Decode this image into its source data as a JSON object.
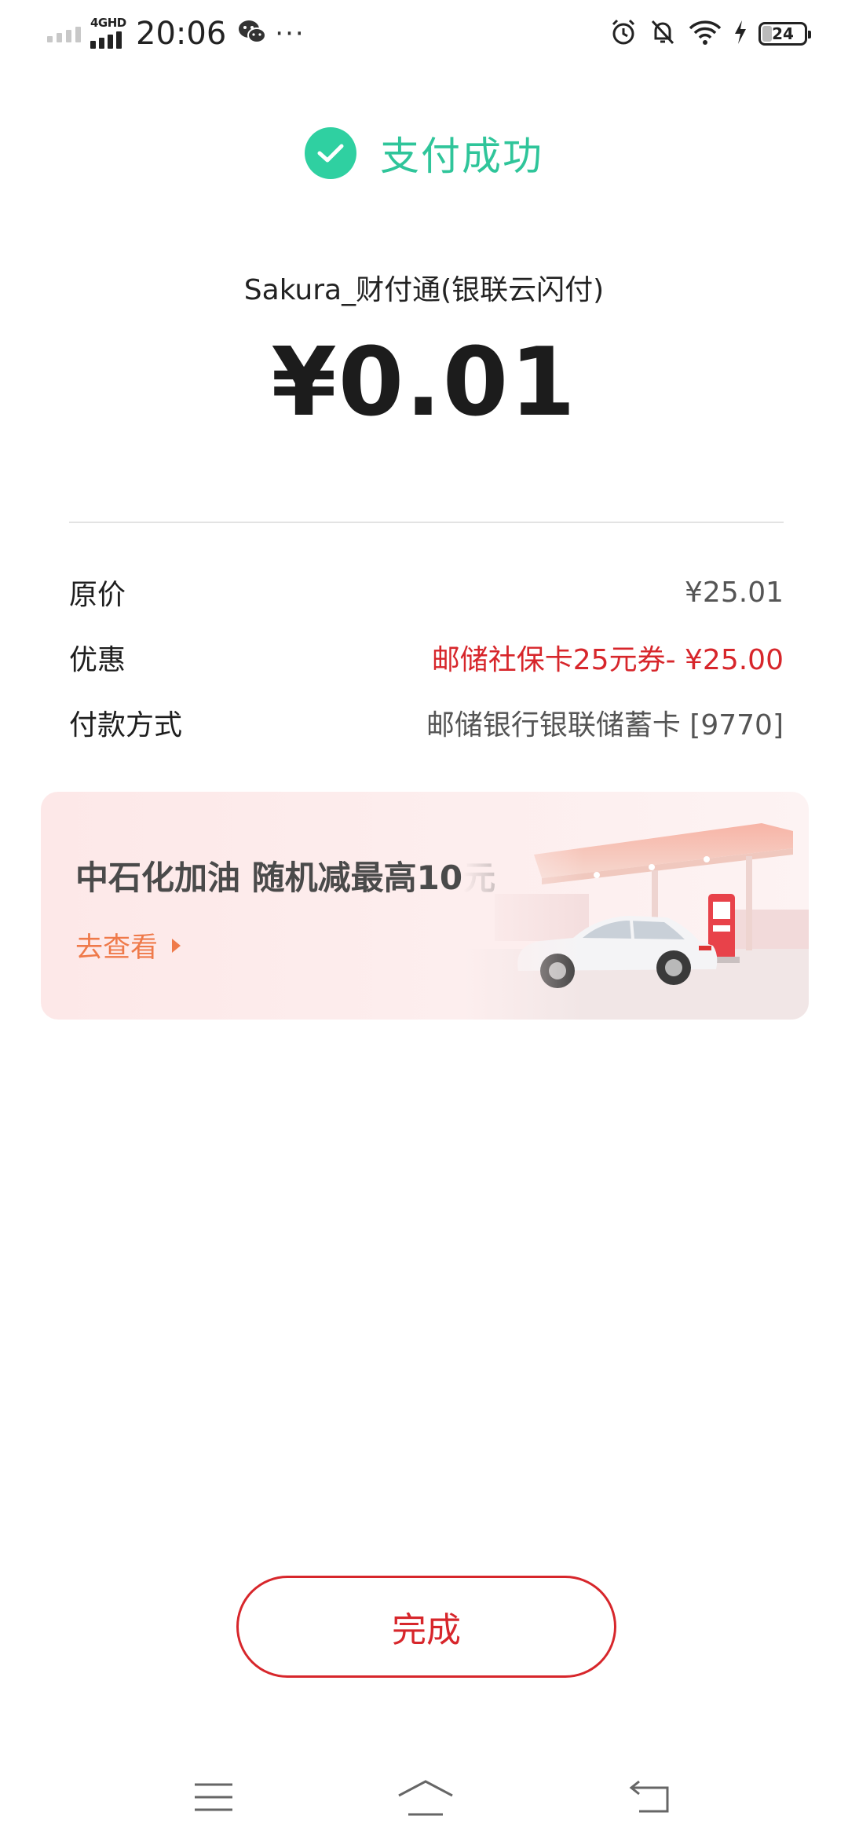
{
  "status_bar": {
    "network": "4GHD",
    "time": "20:06",
    "more": "···",
    "battery": "24"
  },
  "payment": {
    "status": "支付成功",
    "merchant": "Sakura_财付通(银联云闪付)",
    "amount": "¥0.01"
  },
  "details": [
    {
      "label": "原价",
      "value": "¥25.01",
      "highlight": false
    },
    {
      "label": "优惠",
      "value": "邮储社保卡25元券- ¥25.00",
      "highlight": true
    },
    {
      "label": "付款方式",
      "value": "邮储银行银联储蓄卡 [9770]",
      "highlight": false
    }
  ],
  "promo": {
    "title": "中石化加油 随机减最高10元",
    "link": "去查看",
    "image": "car-at-gas-station-illustration"
  },
  "actions": {
    "done": "完成"
  },
  "colors": {
    "success": "#2fd0a1",
    "accent_red": "#d7262b",
    "promo_link": "#ef7a4a",
    "promo_bg": "#fde8e8"
  },
  "navigation": {
    "icons": [
      "menu-icon",
      "home-icon",
      "back-icon"
    ]
  }
}
